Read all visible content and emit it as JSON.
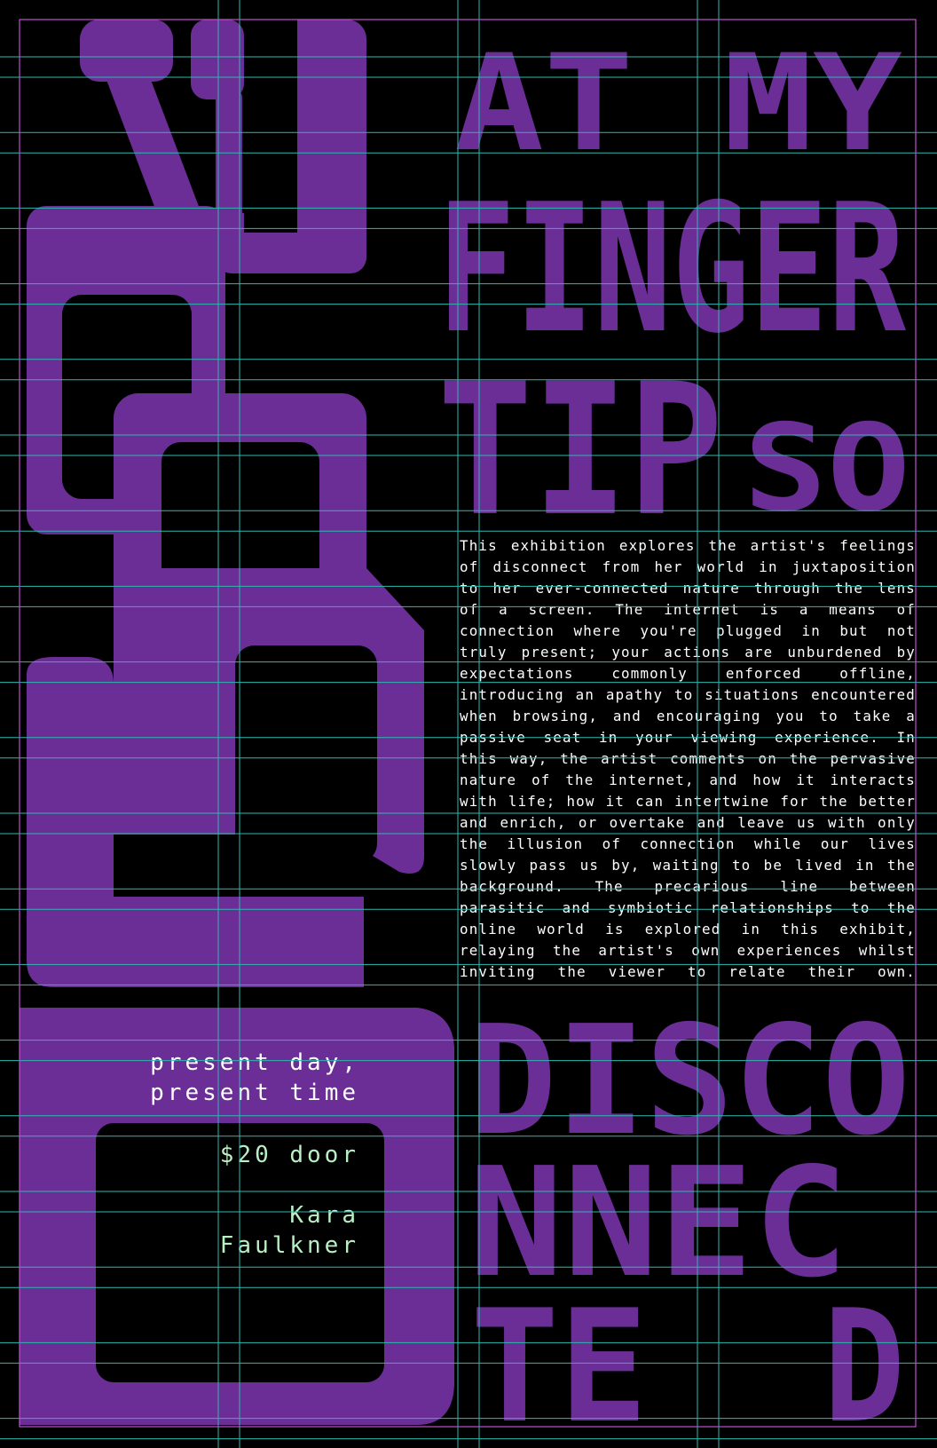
{
  "title": {
    "line1": "AT MY",
    "line2": "FINGER",
    "line3": "TIP",
    "line3_small": "SO",
    "line4": "DISCO",
    "line5": "NNEC",
    "line6a": "TE",
    "line6b": "D"
  },
  "description": "This exhibition explores the artist's feelings of disconnect from her world in juxtaposition to her ever-connected nature through the lens of a screen. The internet is a means of connection where you're plugged in but not truly present; your actions are unburdened by expectations commonly enforced offline, introducing an apathy to situations encountered when browsing, and encouraging you to take a passive seat in your viewing experience. In this way, the artist comments on the pervasive nature of the internet, and how it interacts with life; how it can intertwine for the better and enrich, or overtake and leave us with only the illusion of connection while our lives slowly pass us by, waiting to be lived in the background. The precarious line between parasitic and symbiotic relationships to the online world is explored in this exhibit, relaying the artist's own experiences whilst inviting the viewer to relate their own.",
  "details": {
    "date": "present day,\npresent time",
    "price": "$20 door",
    "artist": "Kara\nFaulkner"
  },
  "colors": {
    "background": "#000000",
    "purple": "#6B2E96",
    "guide_cyan": "#2fb7b0",
    "guide_magenta": "#c04fd0",
    "body_text": "#ffffff",
    "mint_text": "#b8f0c4"
  }
}
